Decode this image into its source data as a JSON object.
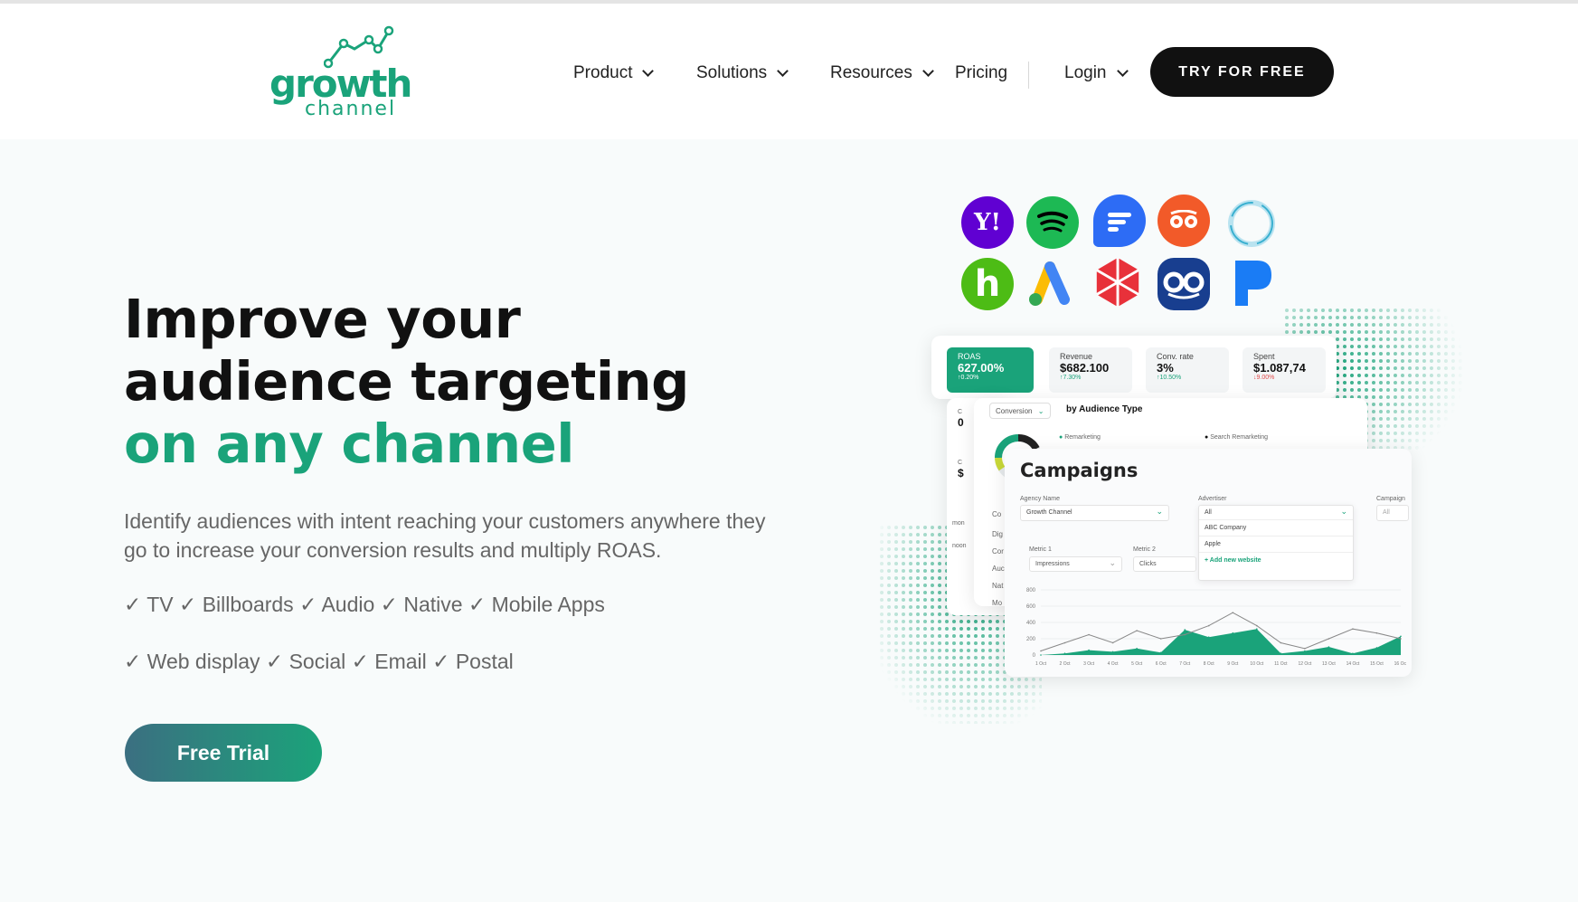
{
  "logo": {
    "word1": "growth",
    "word2": "channel"
  },
  "nav": {
    "items": [
      {
        "label": "Product",
        "dropdown": true
      },
      {
        "label": "Solutions",
        "dropdown": true
      },
      {
        "label": "Resources",
        "dropdown": true
      },
      {
        "label": "Pricing",
        "dropdown": false
      },
      {
        "label": "Login",
        "dropdown": true
      }
    ],
    "cta": "TRY FOR FREE"
  },
  "hero": {
    "title_line1": "Improve your",
    "title_line2": "audience targeting",
    "title_line3": "on any channel",
    "description": "Identify audiences with intent reaching your customers anywhere they go to increase your conversion results and multiply ROAS.",
    "channels_line1": "✓ TV ✓ Billboards ✓ Audio ✓ Native ✓ Mobile Apps",
    "channels_line2": "✓ Web display ✓ Social ✓ Email ✓ Postal",
    "cta": "Free Trial"
  },
  "channel_icons": [
    "yahoo-icon",
    "spotify-icon",
    "sendible-icon",
    "tripadvisor-icon",
    "ring-icon",
    "houzz-icon",
    "google-ads-icon",
    "red-star-icon",
    "oo-icon",
    "pandora-icon"
  ],
  "dashboard": {
    "kpis": [
      {
        "label": "ROAS",
        "value": "627.00%",
        "delta": "↑0.20%",
        "highlight": true
      },
      {
        "label": "Revenue",
        "value": "$682.100",
        "delta": "↑7.30%"
      },
      {
        "label": "Conv. rate",
        "value": "3%",
        "delta": "↑10.50%"
      },
      {
        "label": "Spent",
        "value": "$1.087,74",
        "delta": "↓9.00%"
      }
    ],
    "audience_panel": {
      "dropdown": "Conversion",
      "title": "by Audience Type",
      "legend1": "Remarketing",
      "legend2": "Search Remarketing"
    },
    "left_stub": {
      "items": [
        "Co",
        "Dig",
        "Cor",
        "Auc",
        "Nat",
        "Mo"
      ],
      "c1": "C",
      "c1v": "0",
      "c2": "C",
      "c2v": "$",
      "s1": "mon",
      "s2": "noon"
    },
    "campaigns": {
      "title": "Campaigns",
      "agency_label": "Agency Name",
      "agency_value": "Growth Channel",
      "advertiser_label": "Advertiser",
      "advertiser_value": "All",
      "advertiser_options": [
        "ABC Company",
        "Apple"
      ],
      "add_website": "+ Add new website",
      "campaign_label": "Campaign",
      "campaign_value": "All",
      "metric1_label": "Metric 1",
      "metric1_value": "Impressions",
      "metric2_label": "Metric 2",
      "metric2_value": "Clicks"
    },
    "chart_data": {
      "type": "area",
      "categories": [
        "1 Oct",
        "2 Oct",
        "3 Oct",
        "4 Oct",
        "5 Oct",
        "6 Oct",
        "7 Oct",
        "8 Oct",
        "9 Oct",
        "10 Oct",
        "11 Oct",
        "12 Oct",
        "13 Oct",
        "14 Oct",
        "15 Oct",
        "16 Oct"
      ],
      "yticks": [
        "0",
        "200",
        "400",
        "600",
        "800"
      ],
      "ylim": [
        0,
        800
      ],
      "series": [
        {
          "values": [
            0,
            20,
            60,
            40,
            80,
            30,
            310,
            220,
            270,
            320,
            20,
            50,
            100,
            20,
            90,
            230
          ],
          "color": "#1aa37a"
        },
        {
          "values": [
            50,
            150,
            250,
            150,
            300,
            200,
            250,
            360,
            520,
            360,
            150,
            80,
            200,
            320,
            270,
            200
          ],
          "color": "#888888"
        }
      ]
    }
  }
}
